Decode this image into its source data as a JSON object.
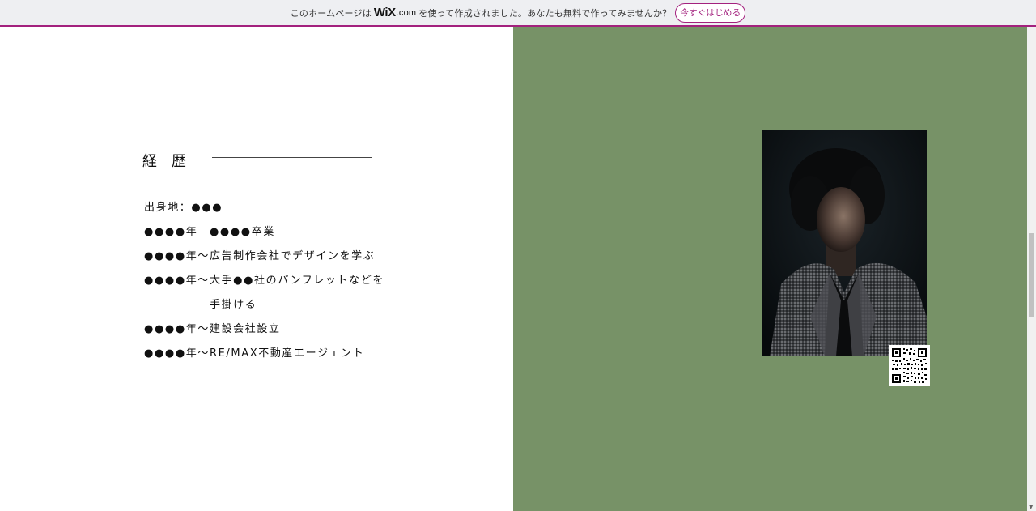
{
  "wix_banner": {
    "text_before": "このホームページは",
    "logo": "WiX",
    "logo_suffix": ".com",
    "text_after": "を使って作成されました。あなたも無料で作ってみませんか？",
    "start_button": "今すぐはじめる",
    "accent_color": "#a3217e"
  },
  "career": {
    "title": "経歴",
    "items": [
      {
        "text": "出身地：●●●",
        "indent": false
      },
      {
        "text": "●●●●年　●●●●卒業",
        "indent": false
      },
      {
        "text": "●●●●年～広告制作会社でデザインを学ぶ",
        "indent": false
      },
      {
        "text": "●●●●年～大手●●社のパンフレットなどを",
        "indent": false
      },
      {
        "text": "手掛ける",
        "indent": true
      },
      {
        "text": "●●●●年～建設会社設立",
        "indent": false
      },
      {
        "text": "●●●●年～RE/MAX不動産エージェント",
        "indent": false
      }
    ]
  },
  "right_panel": {
    "background_color": "#779267",
    "portrait_icon": "portrait-photo",
    "qr_icon": "qr-code-icon"
  },
  "scrollbar": {
    "arrow_icon": "chevron-down-icon",
    "arrow_glyph": "▼"
  }
}
